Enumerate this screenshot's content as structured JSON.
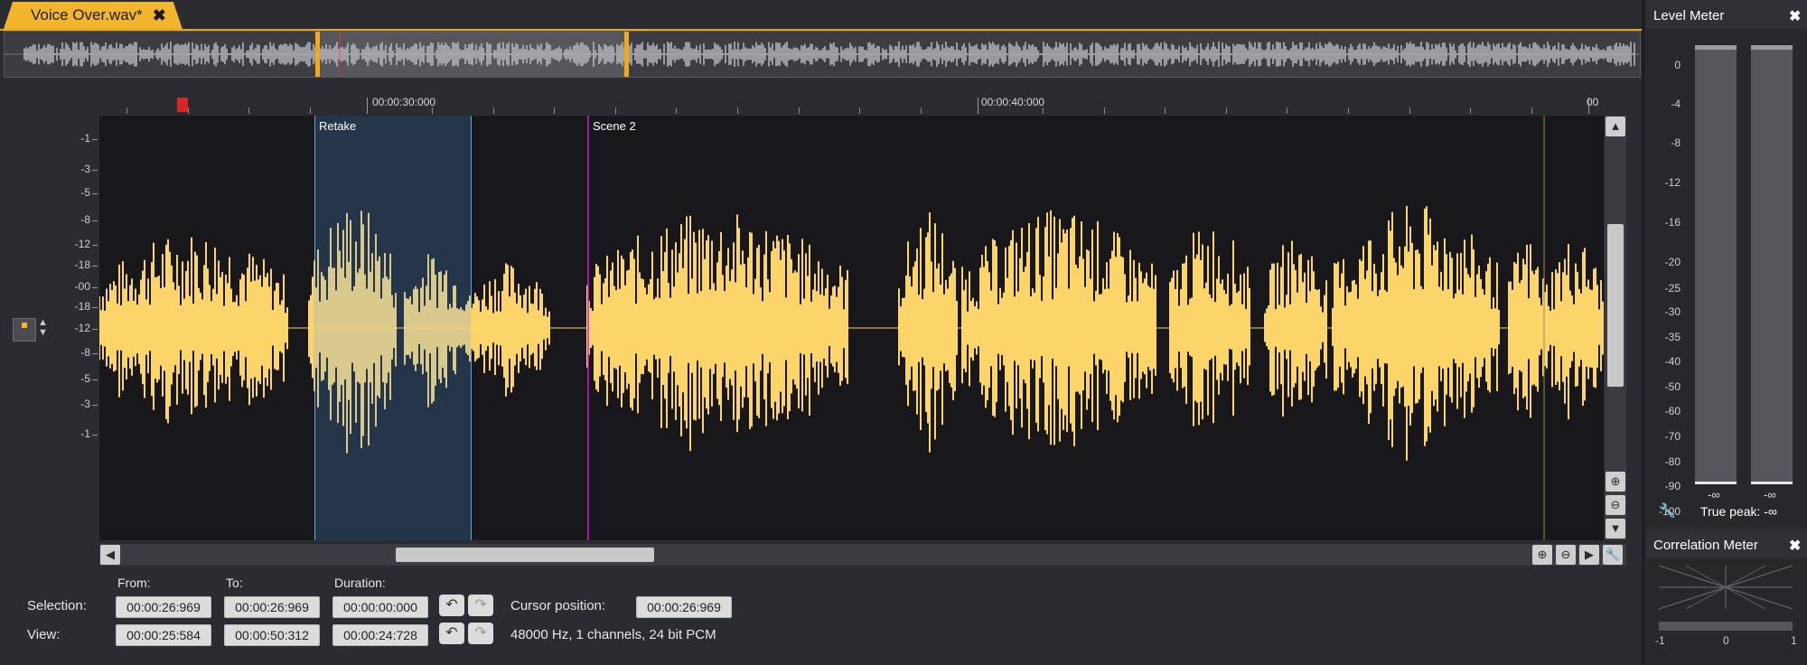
{
  "tab": {
    "title": "Voice Over.wav*",
    "close_glyph": "✖"
  },
  "ruler": {
    "labels": [
      "00:00:30:000",
      "00:00:40:000",
      "00"
    ]
  },
  "markers": [
    {
      "label": "Retake",
      "color": "#6aa3da"
    },
    {
      "label": "Scene 2",
      "color": "#d21ed2"
    }
  ],
  "db_scale": [
    "-1",
    "-3",
    "-5",
    "-8",
    "-12",
    "-18",
    "-00",
    "-18",
    "-12",
    "-8",
    "-5",
    "-3",
    "-1"
  ],
  "waveform": {
    "color": "#fbd46a",
    "selected_color": "#d9c98c"
  },
  "bottom": {
    "headers": {
      "from": "From:",
      "to": "To:",
      "duration": "Duration:"
    },
    "selection": {
      "label": "Selection:",
      "from": "00:00:26:969",
      "to": "00:00:26:969",
      "duration": "00:00:00:000"
    },
    "view": {
      "label": "View:",
      "from": "00:00:25:584",
      "to": "00:00:50:312",
      "duration": "00:00:24:728"
    },
    "cursor": {
      "label": "Cursor position:",
      "value": "00:00:26:969"
    },
    "format": "48000 Hz, 1 channels, 24 bit PCM"
  },
  "level_meter": {
    "title": "Level Meter",
    "scale": [
      "0",
      "-4",
      "-8",
      "-12",
      "-16",
      "-20",
      "-25",
      "-30",
      "-35",
      "-40",
      "-50",
      "-60",
      "-70",
      "-80",
      "-90",
      "-100"
    ],
    "left_value": "-∞",
    "right_value": "-∞",
    "true_peak": "True peak: -∞"
  },
  "correlation_meter": {
    "title": "Correlation Meter",
    "scale": [
      "-1",
      "0",
      "1"
    ]
  },
  "icons": {
    "close": "close-icon",
    "zoom_in": "zoom-in-icon",
    "zoom_out": "zoom-out-icon",
    "wrench": "wrench-icon",
    "undo": "undo-icon",
    "redo": "redo-icon"
  }
}
